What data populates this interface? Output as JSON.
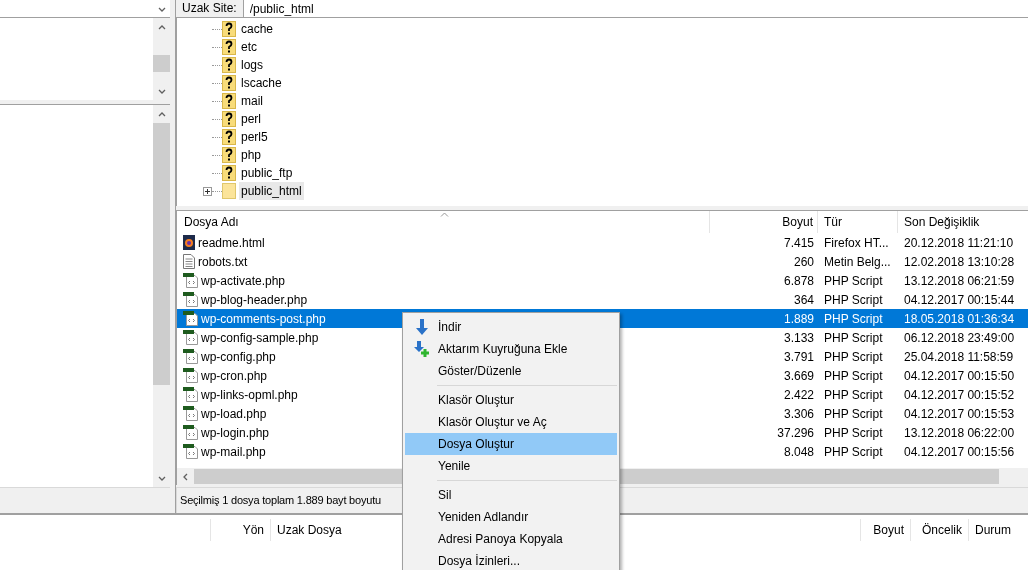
{
  "remote": {
    "address": {
      "label": "Uzak Site:",
      "value": "/public_html"
    },
    "tree": [
      {
        "name": "cache",
        "kind": "unknown",
        "expandable": false,
        "selected": false
      },
      {
        "name": "etc",
        "kind": "unknown",
        "expandable": false,
        "selected": false
      },
      {
        "name": "logs",
        "kind": "unknown",
        "expandable": false,
        "selected": false
      },
      {
        "name": "lscache",
        "kind": "unknown",
        "expandable": false,
        "selected": false
      },
      {
        "name": "mail",
        "kind": "unknown",
        "expandable": false,
        "selected": false
      },
      {
        "name": "perl",
        "kind": "unknown",
        "expandable": false,
        "selected": false
      },
      {
        "name": "perl5",
        "kind": "unknown",
        "expandable": false,
        "selected": false
      },
      {
        "name": "php",
        "kind": "unknown",
        "expandable": false,
        "selected": false
      },
      {
        "name": "public_ftp",
        "kind": "unknown",
        "expandable": false,
        "selected": false
      },
      {
        "name": "public_html",
        "kind": "folder",
        "expandable": true,
        "selected": true
      }
    ],
    "table": {
      "columns": [
        "Dosya Adı",
        "Boyut",
        "Tür",
        "Son Değişiklik"
      ],
      "rows": [
        {
          "kind": "firefox",
          "name": "readme.html",
          "size": "7.415",
          "type": "Firefox HT...",
          "modified": "20.12.2018 11:21:10",
          "selected": false
        },
        {
          "kind": "text",
          "name": "robots.txt",
          "size": "260",
          "type": "Metin Belg...",
          "modified": "12.02.2018 13:10:28",
          "selected": false
        },
        {
          "kind": "php",
          "name": "wp-activate.php",
          "size": "6.878",
          "type": "PHP Script",
          "modified": "13.12.2018 06:21:59",
          "selected": false
        },
        {
          "kind": "php",
          "name": "wp-blog-header.php",
          "size": "364",
          "type": "PHP Script",
          "modified": "04.12.2017 00:15:44",
          "selected": false
        },
        {
          "kind": "php",
          "name": "wp-comments-post.php",
          "size": "1.889",
          "type": "PHP Script",
          "modified": "18.05.2018 01:36:34",
          "selected": true
        },
        {
          "kind": "php",
          "name": "wp-config-sample.php",
          "size": "3.133",
          "type": "PHP Script",
          "modified": "06.12.2018 23:49:00",
          "selected": false
        },
        {
          "kind": "php",
          "name": "wp-config.php",
          "size": "3.791",
          "type": "PHP Script",
          "modified": "25.04.2018 11:58:59",
          "selected": false
        },
        {
          "kind": "php",
          "name": "wp-cron.php",
          "size": "3.669",
          "type": "PHP Script",
          "modified": "04.12.2017 00:15:50",
          "selected": false
        },
        {
          "kind": "php",
          "name": "wp-links-opml.php",
          "size": "2.422",
          "type": "PHP Script",
          "modified": "04.12.2017 00:15:52",
          "selected": false
        },
        {
          "kind": "php",
          "name": "wp-load.php",
          "size": "3.306",
          "type": "PHP Script",
          "modified": "04.12.2017 00:15:53",
          "selected": false
        },
        {
          "kind": "php",
          "name": "wp-login.php",
          "size": "37.296",
          "type": "PHP Script",
          "modified": "13.12.2018 06:22:00",
          "selected": false
        },
        {
          "kind": "php",
          "name": "wp-mail.php",
          "size": "8.048",
          "type": "PHP Script",
          "modified": "04.12.2017 00:15:56",
          "selected": false
        }
      ]
    },
    "status_bar": "Seçilmiş 1 dosya toplam 1.889 bayt boyutu"
  },
  "queue": {
    "columns": [
      "",
      "Yön",
      "Uzak Dosya",
      "",
      "Boyut",
      "Öncelik",
      "Durum"
    ]
  },
  "context_menu": [
    {
      "kind": "item",
      "label": "İndir",
      "selected": false
    },
    {
      "kind": "item",
      "label": "Aktarım Kuyruğuna Ekle",
      "selected": false
    },
    {
      "kind": "item",
      "label": "Göster/Düzenle",
      "selected": false
    },
    {
      "kind": "separator"
    },
    {
      "kind": "item",
      "label": "Klasör Oluştur",
      "selected": false
    },
    {
      "kind": "item",
      "label": "Klasör Oluştur ve Aç",
      "selected": false
    },
    {
      "kind": "item",
      "label": "Dosya Oluştur",
      "selected": true
    },
    {
      "kind": "item",
      "label": "Yenile",
      "selected": false
    },
    {
      "kind": "separator"
    },
    {
      "kind": "item",
      "label": "Sil",
      "selected": false
    },
    {
      "kind": "item",
      "label": "Yeniden Adlandır",
      "selected": false
    },
    {
      "kind": "item",
      "label": "Adresi Panoya Kopyala",
      "selected": false
    },
    {
      "kind": "item",
      "label": "Dosya İzinleri...",
      "selected": false
    }
  ]
}
